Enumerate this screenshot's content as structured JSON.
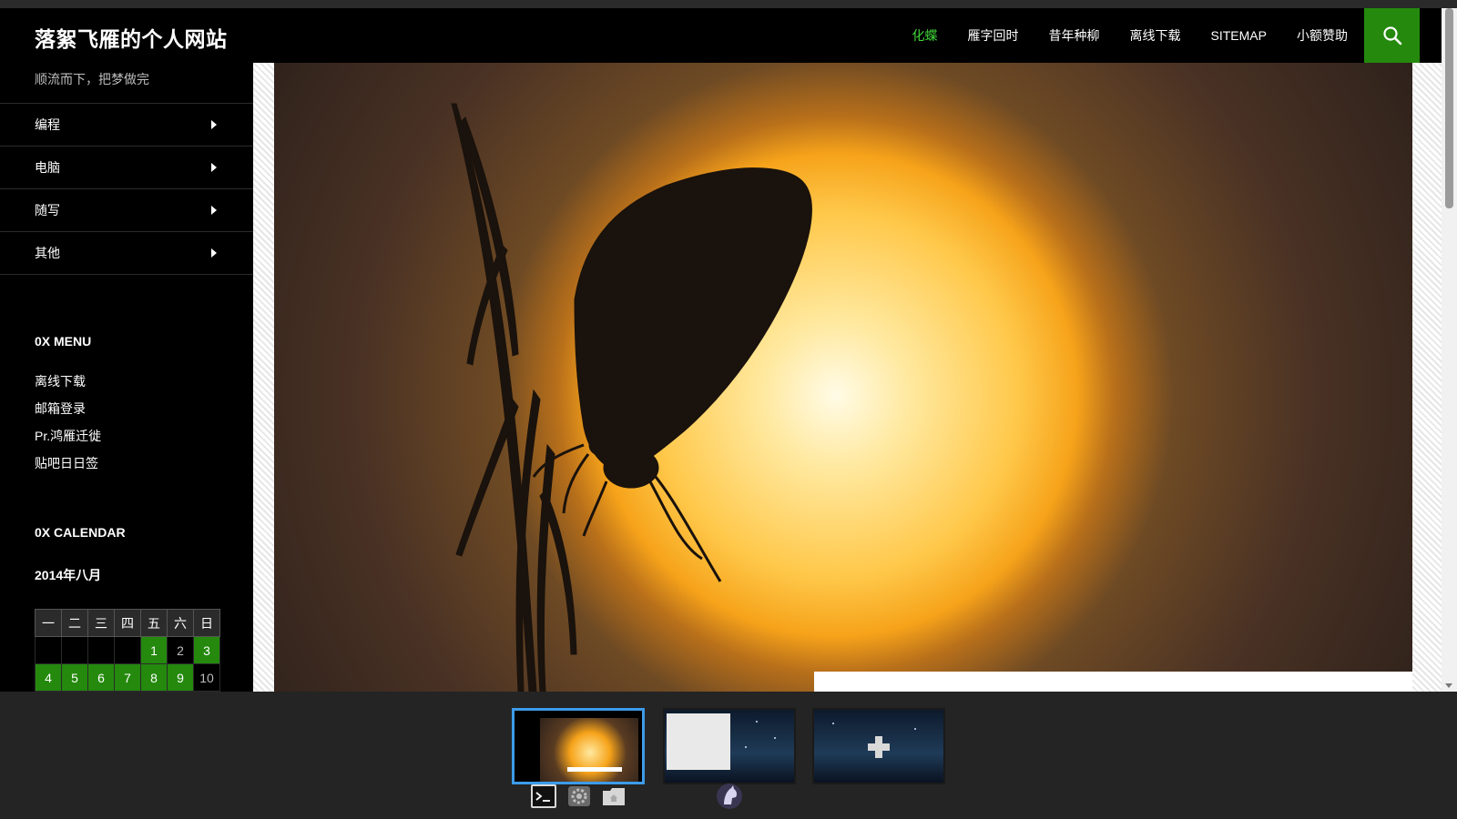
{
  "site": {
    "title": "落絮飞雁的个人网站",
    "tagline": "顺流而下，把梦做完"
  },
  "nav": {
    "items": [
      {
        "label": "化蝶",
        "active": true
      },
      {
        "label": "雁字回时"
      },
      {
        "label": "昔年种柳"
      },
      {
        "label": "离线下载"
      },
      {
        "label": "SITEMAP"
      },
      {
        "label": "小额赞助"
      }
    ],
    "search_icon": "search-icon",
    "accent_color": "#24890d",
    "active_color": "#41d83a"
  },
  "sidebar": {
    "menu": [
      "编程",
      "电脑",
      "随写",
      "其他"
    ],
    "widget_menu_title": "0X MENU",
    "links": [
      "离线下载",
      "邮箱登录",
      "Pr.鸿雁迁徙",
      "贴吧日日签"
    ],
    "widget_calendar_title": "0X CALENDAR"
  },
  "calendar": {
    "caption": "2014年八月",
    "weekdays": [
      "一",
      "二",
      "三",
      "四",
      "五",
      "六",
      "日"
    ],
    "row1": [
      "",
      "",
      "",
      "",
      "1",
      "2",
      "3"
    ],
    "row2": [
      "4",
      "5",
      "6",
      "7",
      "8",
      "9",
      "10"
    ]
  },
  "workspaces": {
    "count": 3,
    "current": 1,
    "add_icon": "plus-icon",
    "dock_icons": [
      "terminal-icon",
      "gear-icon",
      "folder-icon",
      "horse-icon"
    ]
  }
}
